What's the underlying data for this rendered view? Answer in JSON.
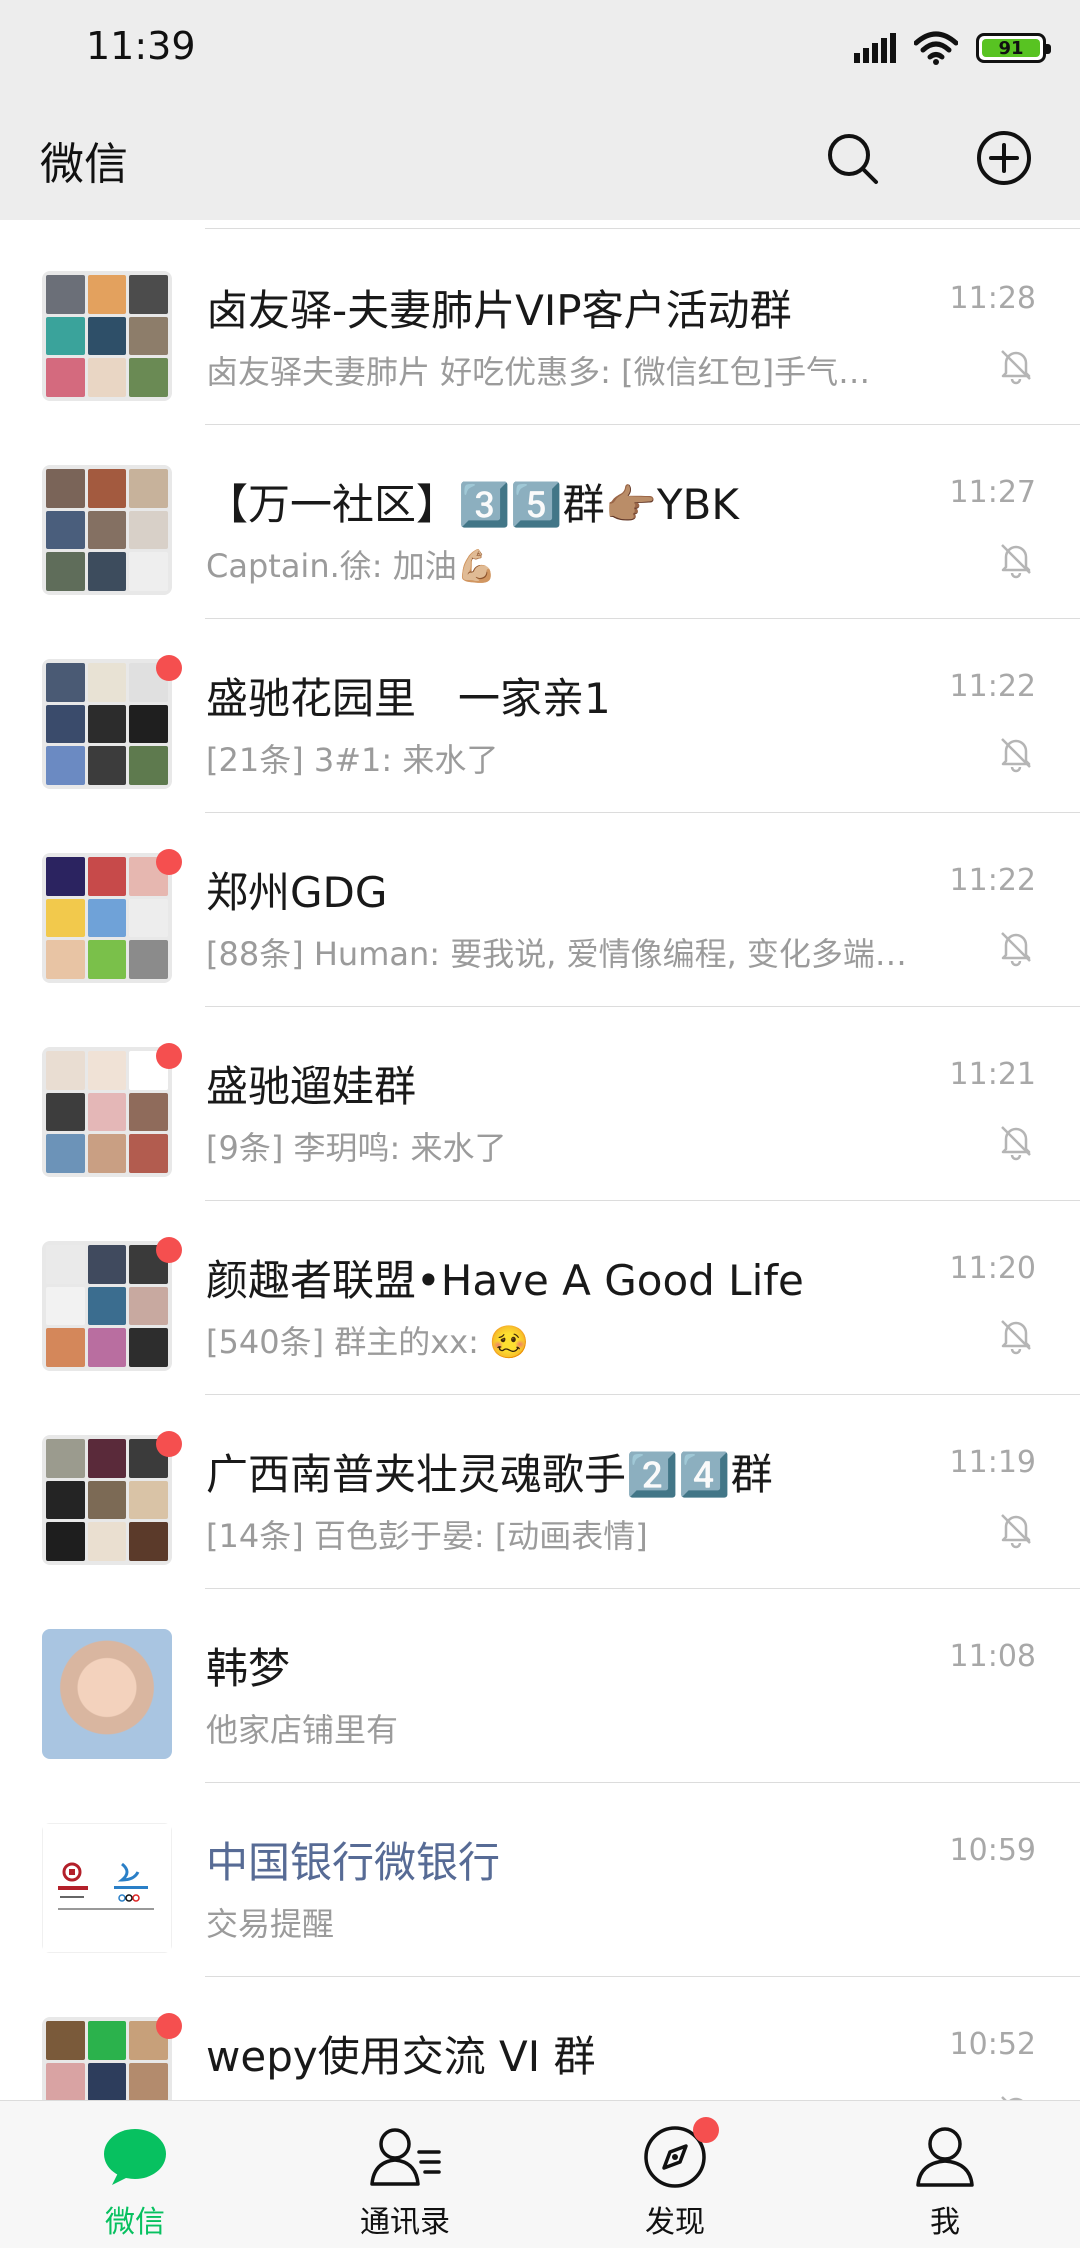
{
  "status_bar": {
    "time": "11:39",
    "battery": "91"
  },
  "header": {
    "title": "微信",
    "search_icon": "search-icon",
    "add_icon": "plus-circle-icon"
  },
  "chats": [
    {
      "name": "卤友驿-夫妻肺片VIP客户活动群",
      "preview": "卤友驿夫妻肺片 好吃优惠多: [微信红包]手气…",
      "time": "11:28",
      "muted": true,
      "unread_dot": false,
      "avatar": "group-grid"
    },
    {
      "name": "【万一社区】3️⃣5️⃣群👉🏽YBK",
      "preview": "Captain.徐: 加油💪🏼",
      "time": "11:27",
      "muted": true,
      "unread_dot": false,
      "avatar": "group-grid"
    },
    {
      "name": "盛驰花园里　一家亲1",
      "preview": "[21条] 3#1: 来水了",
      "time": "11:22",
      "muted": true,
      "unread_dot": true,
      "avatar": "group-grid"
    },
    {
      "name": "郑州GDG",
      "preview": "[88条] Human: 要我说, 爱情像编程, 变化多端,…",
      "time": "11:22",
      "muted": true,
      "unread_dot": true,
      "avatar": "group-grid"
    },
    {
      "name": "盛驰遛娃群",
      "preview": "[9条] 李玥鸣: 来水了",
      "time": "11:21",
      "muted": true,
      "unread_dot": true,
      "avatar": "group-grid"
    },
    {
      "name": "颜趣者联盟•Have A Good Life",
      "preview": "[540条] 群主的xx: 🥴",
      "time": "11:20",
      "muted": true,
      "unread_dot": true,
      "avatar": "group-grid"
    },
    {
      "name": "广西南普夹壮灵魂歌手2️⃣4️⃣群",
      "preview": "[14条] 百色彭于晏: [动画表情]",
      "time": "11:19",
      "muted": true,
      "unread_dot": true,
      "avatar": "group-grid"
    },
    {
      "name": "韩梦",
      "preview": "他家店铺里有",
      "time": "11:08",
      "muted": false,
      "unread_dot": false,
      "avatar": "photo"
    },
    {
      "name": "中国银行微银行",
      "preview": "交易提醒",
      "time": "10:59",
      "muted": false,
      "unread_dot": false,
      "avatar": "bank",
      "official": true
    },
    {
      "name": "wepy使用交流 VI 群",
      "preview": "",
      "time": "10:52",
      "muted": true,
      "unread_dot": true,
      "avatar": "group-grid"
    }
  ],
  "tabs": [
    {
      "label": "微信",
      "icon": "chat-bubble-icon",
      "active": true
    },
    {
      "label": "通讯录",
      "icon": "contacts-icon",
      "active": false
    },
    {
      "label": "发现",
      "icon": "compass-icon",
      "active": false,
      "dot": true
    },
    {
      "label": "我",
      "icon": "person-icon",
      "active": false
    }
  ],
  "colors": {
    "accent": "#07c160",
    "badge": "#f54f4f",
    "header_bg": "#ededed",
    "official_name": "#576b95"
  }
}
